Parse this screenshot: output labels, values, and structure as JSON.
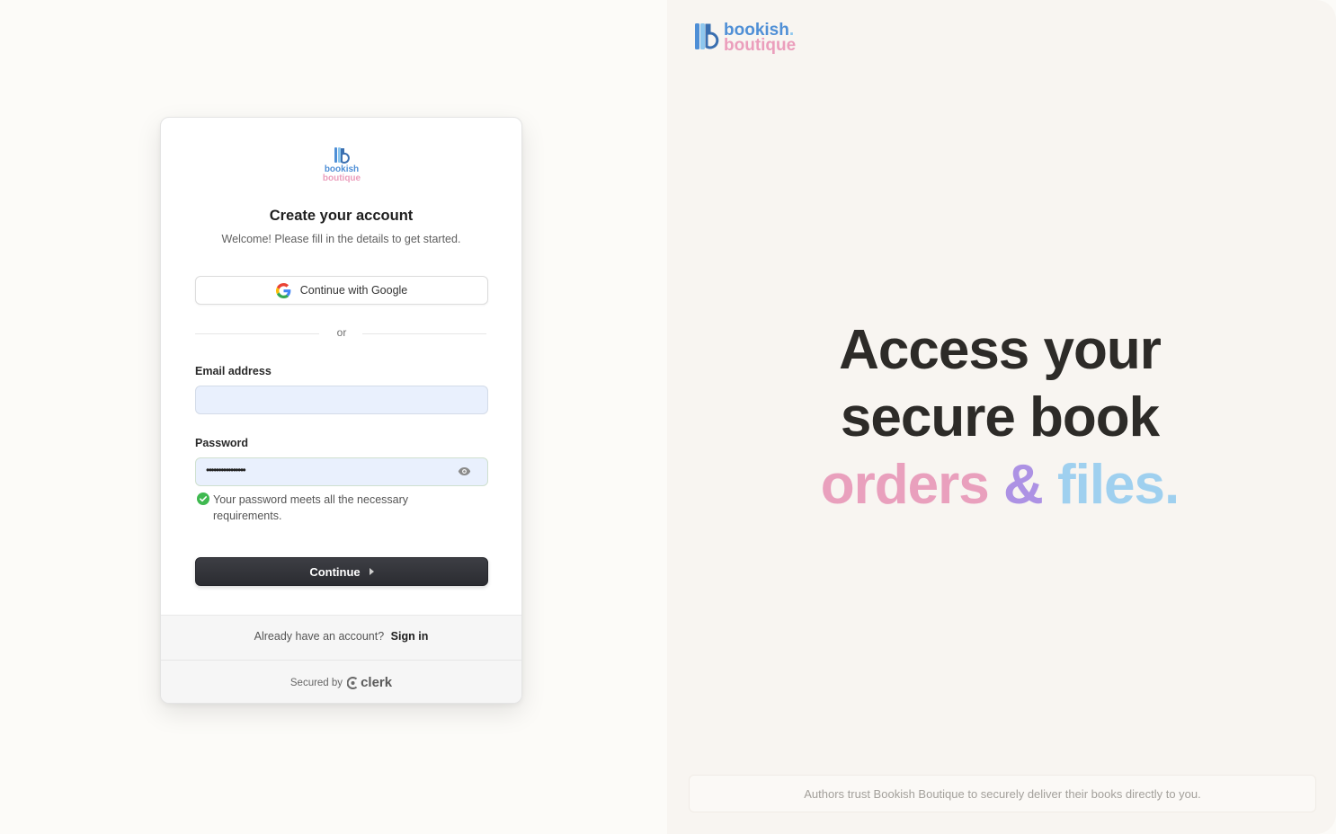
{
  "card": {
    "logo": {
      "word1": "bookish",
      "word2": "boutique"
    },
    "title": "Create your account",
    "subtitle": "Welcome! Please fill in the details to get started.",
    "google_button": "Continue with Google",
    "divider": "or",
    "email": {
      "label": "Email address",
      "value": "",
      "placeholder": ""
    },
    "password": {
      "label": "Password",
      "masked_value": "••••••••••••••••",
      "hint": "Your password meets all the necessary requirements."
    },
    "continue_button": "Continue",
    "footer": {
      "prompt": "Already have an account?",
      "signin_link": "Sign in",
      "secured_by": "Secured by",
      "provider": "clerk"
    }
  },
  "brand": {
    "word1": "bookish",
    "word1_dot": ".",
    "word2": "boutique"
  },
  "hero": {
    "line1": "Access your",
    "line2": "secure book",
    "word_orders": "orders",
    "amp": "&",
    "word_files": "files",
    "period": "."
  },
  "trust_text": "Authors trust Bookish Boutique to securely deliver their books directly to you.",
  "colors": {
    "brand_blue": "#4f8fd6",
    "brand_pink": "#eb9ebc",
    "hero_pink": "#e9a0bd",
    "hero_purple": "#ad92e4",
    "hero_blue": "#9fd0ef",
    "button_dark": "#2b2c31",
    "success_green": "#3fb950"
  }
}
